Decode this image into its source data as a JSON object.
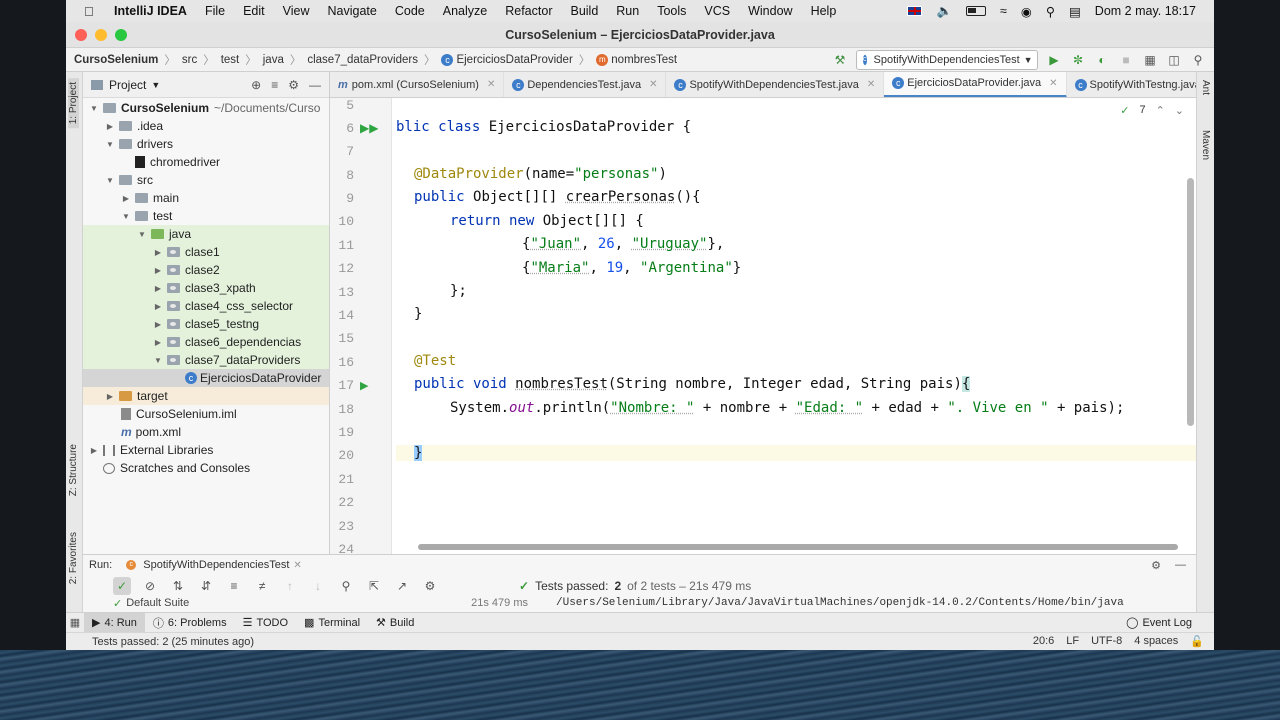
{
  "menubar": {
    "app_name": "IntelliJ IDEA",
    "items": [
      "File",
      "Edit",
      "View",
      "Navigate",
      "Code",
      "Analyze",
      "Refactor",
      "Build",
      "Run",
      "Tools",
      "VCS",
      "Window",
      "Help"
    ],
    "datetime": "Dom 2 may.  18:17"
  },
  "window": {
    "title": "CursoSelenium – EjerciciosDataProvider.java"
  },
  "breadcrumb": {
    "project": "CursoSelenium",
    "parts": [
      "src",
      "test",
      "java",
      "clase7_dataProviders"
    ],
    "class": "EjerciciosDataProvider",
    "method": "nombresTest"
  },
  "run_config": {
    "selected": "SpotifyWithDependenciesTest"
  },
  "sidebar_tools": {
    "project": "1: Project",
    "structure": "Z: Structure",
    "favorites": "2: Favorites",
    "ant": "Ant",
    "maven": "Maven"
  },
  "project_panel": {
    "title": "Project",
    "root_name": "CursoSelenium",
    "root_path": "~/Documents/Curso",
    "items": {
      "idea": ".idea",
      "drivers": "drivers",
      "chromedriver": "chromedriver",
      "src": "src",
      "main": "main",
      "test": "test",
      "java": "java",
      "clase1": "clase1",
      "clase2": "clase2",
      "clase3": "clase3_xpath",
      "clase4": "clase4_css_selector",
      "clase5": "clase5_testng",
      "clase6": "clase6_dependencias",
      "clase7": "clase7_dataProviders",
      "ejercicios": "EjerciciosDataProvider",
      "target": "target",
      "iml": "CursoSelenium.iml",
      "pom": "pom.xml",
      "external": "External Libraries",
      "scratches": "Scratches and Consoles"
    }
  },
  "editor_tabs": [
    {
      "label": "pom.xml (CursoSelenium)"
    },
    {
      "label": "DependenciesTest.java"
    },
    {
      "label": "SpotifyWithDependenciesTest.java"
    },
    {
      "label": "EjerciciosDataProvider.java"
    },
    {
      "label": "SpotifyWithTestng.java"
    }
  ],
  "editor": {
    "inspection_count": "7",
    "line_numbers": [
      "5",
      "6",
      "7",
      "8",
      "9",
      "10",
      "11",
      "12",
      "13",
      "14",
      "15",
      "16",
      "17",
      "18",
      "19",
      "20",
      "21",
      "22",
      "23",
      "24"
    ],
    "code": {
      "l6_kw": "blic class ",
      "l6_name": "EjerciciosDataProvider {",
      "l8_ann": "@DataProvider",
      "l8_rest1": "(name=",
      "l8_str": "\"personas\"",
      "l8_rest2": ")",
      "l9_kw": "public ",
      "l9_rest": "Object[][] ",
      "l9_method": "crearPersonas",
      "l9_end": "(){",
      "l10_kw": "return new ",
      "l10_rest": "Object[][] {",
      "l11_open": "{",
      "l11_s1": "\"Juan\"",
      "l11_c1": ", ",
      "l11_n": "26",
      "l11_c2": ", ",
      "l11_s2": "\"Uruguay\"",
      "l11_close": "},",
      "l12_open": "{",
      "l12_s1": "\"Maria\"",
      "l12_c1": ", ",
      "l12_n": "19",
      "l12_c2": ", ",
      "l12_s2": "\"Argentina\"",
      "l12_close": "}",
      "l13": "};",
      "l14": "}",
      "l16_ann": "@Test",
      "l17_kw1": "public void ",
      "l17_method": "nombresTest",
      "l17_rest": "(String nombre, Integer edad, String pais)",
      "l17_brace": "{",
      "l18_a": "System.",
      "l18_out": "out",
      "l18_b": ".println(",
      "l18_s1": "\"Nombre: \"",
      "l18_c": " + nombre + ",
      "l18_s2": "\"Edad: \"",
      "l18_d": " + edad + ",
      "l18_s3": "\". Vive en \"",
      "l18_e": " + pais);",
      "l20_brace": "}"
    }
  },
  "run_panel": {
    "label": "Run:",
    "tab": "SpotifyWithDependenciesTest",
    "tests_passed_label": "Tests passed:",
    "tests_passed_value": "2",
    "tests_passed_detail": "of 2 tests – 21s 479 ms",
    "suite": "Default Suite",
    "suite_time": "21s 479 ms",
    "console_path": "/Users/Selenium/Library/Java/JavaVirtualMachines/openjdk-14.0.2/Contents/Home/bin/java"
  },
  "bottom_tools": {
    "run": "4: Run",
    "problems": "6: Problems",
    "todo": "TODO",
    "terminal": "Terminal",
    "build": "Build",
    "event_log": "Event Log"
  },
  "statusbar": {
    "message": "Tests passed: 2 (25 minutes ago)",
    "position": "20:6",
    "line_sep": "LF",
    "encoding": "UTF-8",
    "indent": "4 spaces"
  },
  "colors": {
    "accent": "#4a86c7",
    "pass_green": "#3a9a3a",
    "test_tree_highlight": "#e4f2dc"
  }
}
